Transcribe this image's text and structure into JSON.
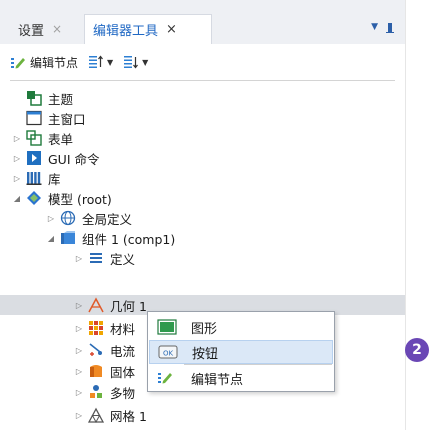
{
  "tabs": [
    {
      "label": "设置",
      "close": "×",
      "active": false
    },
    {
      "label": "编辑器工具",
      "close": "×",
      "active": true
    }
  ],
  "tab_controls": {
    "dropdown": "▼"
  },
  "toolbar": {
    "edit_node_label": "编辑节点",
    "caret": "▼"
  },
  "tree": [
    {
      "label": "主题",
      "icon": "theme-icon",
      "arrow": "",
      "expanded": null
    },
    {
      "label": "主窗口",
      "icon": "window-icon",
      "arrow": "",
      "expanded": null
    },
    {
      "label": "表单",
      "icon": "form-icon",
      "arrow": "▷",
      "expanded": false
    },
    {
      "label": "GUI 命令",
      "icon": "gui-command-icon",
      "arrow": "▷",
      "expanded": false
    },
    {
      "label": "库",
      "icon": "library-icon",
      "arrow": "▷",
      "expanded": false
    },
    {
      "label": "模型 (root)",
      "icon": "model-icon",
      "arrow": "◢",
      "expanded": true
    },
    {
      "label": "全局定义",
      "icon": "global-definitions-icon",
      "arrow": "▷",
      "expanded": false
    },
    {
      "label": "组件 1 (comp1)",
      "icon": "component-icon",
      "arrow": "◢",
      "expanded": true
    },
    {
      "label": "定义",
      "icon": "definitions-icon",
      "arrow": "▷",
      "expanded": false
    },
    {
      "label": "几何 1",
      "icon": "geometry-icon",
      "arrow": "▷",
      "expanded": false,
      "selected": true
    },
    {
      "label": "材料",
      "icon": "materials-icon",
      "arrow": "▷",
      "expanded": false
    },
    {
      "label": "电流",
      "icon": "electric-currents-icon",
      "arrow": "▷",
      "expanded": false
    },
    {
      "label": "固体",
      "icon": "solid-icon",
      "arrow": "▷",
      "expanded": false
    },
    {
      "label": "多物",
      "icon": "multiphysics-icon",
      "arrow": "▷",
      "expanded": false
    },
    {
      "label": "网格 1",
      "icon": "mesh-icon",
      "arrow": "▷",
      "expanded": false
    }
  ],
  "context_menu": {
    "items": [
      {
        "label": "图形",
        "icon": "graphics-icon",
        "hover": false
      },
      {
        "label": "按钮",
        "icon": "button-icon",
        "icon_text": "OK",
        "hover": true
      },
      {
        "label": "编辑节点",
        "icon": "edit-node-icon",
        "hover": false
      }
    ]
  },
  "step_badge": "2",
  "colors": {
    "accent": "#2169c4",
    "selected_row": "#dadde2",
    "menu_hover": "#dbe8f7",
    "badge": "#6a47b5"
  }
}
